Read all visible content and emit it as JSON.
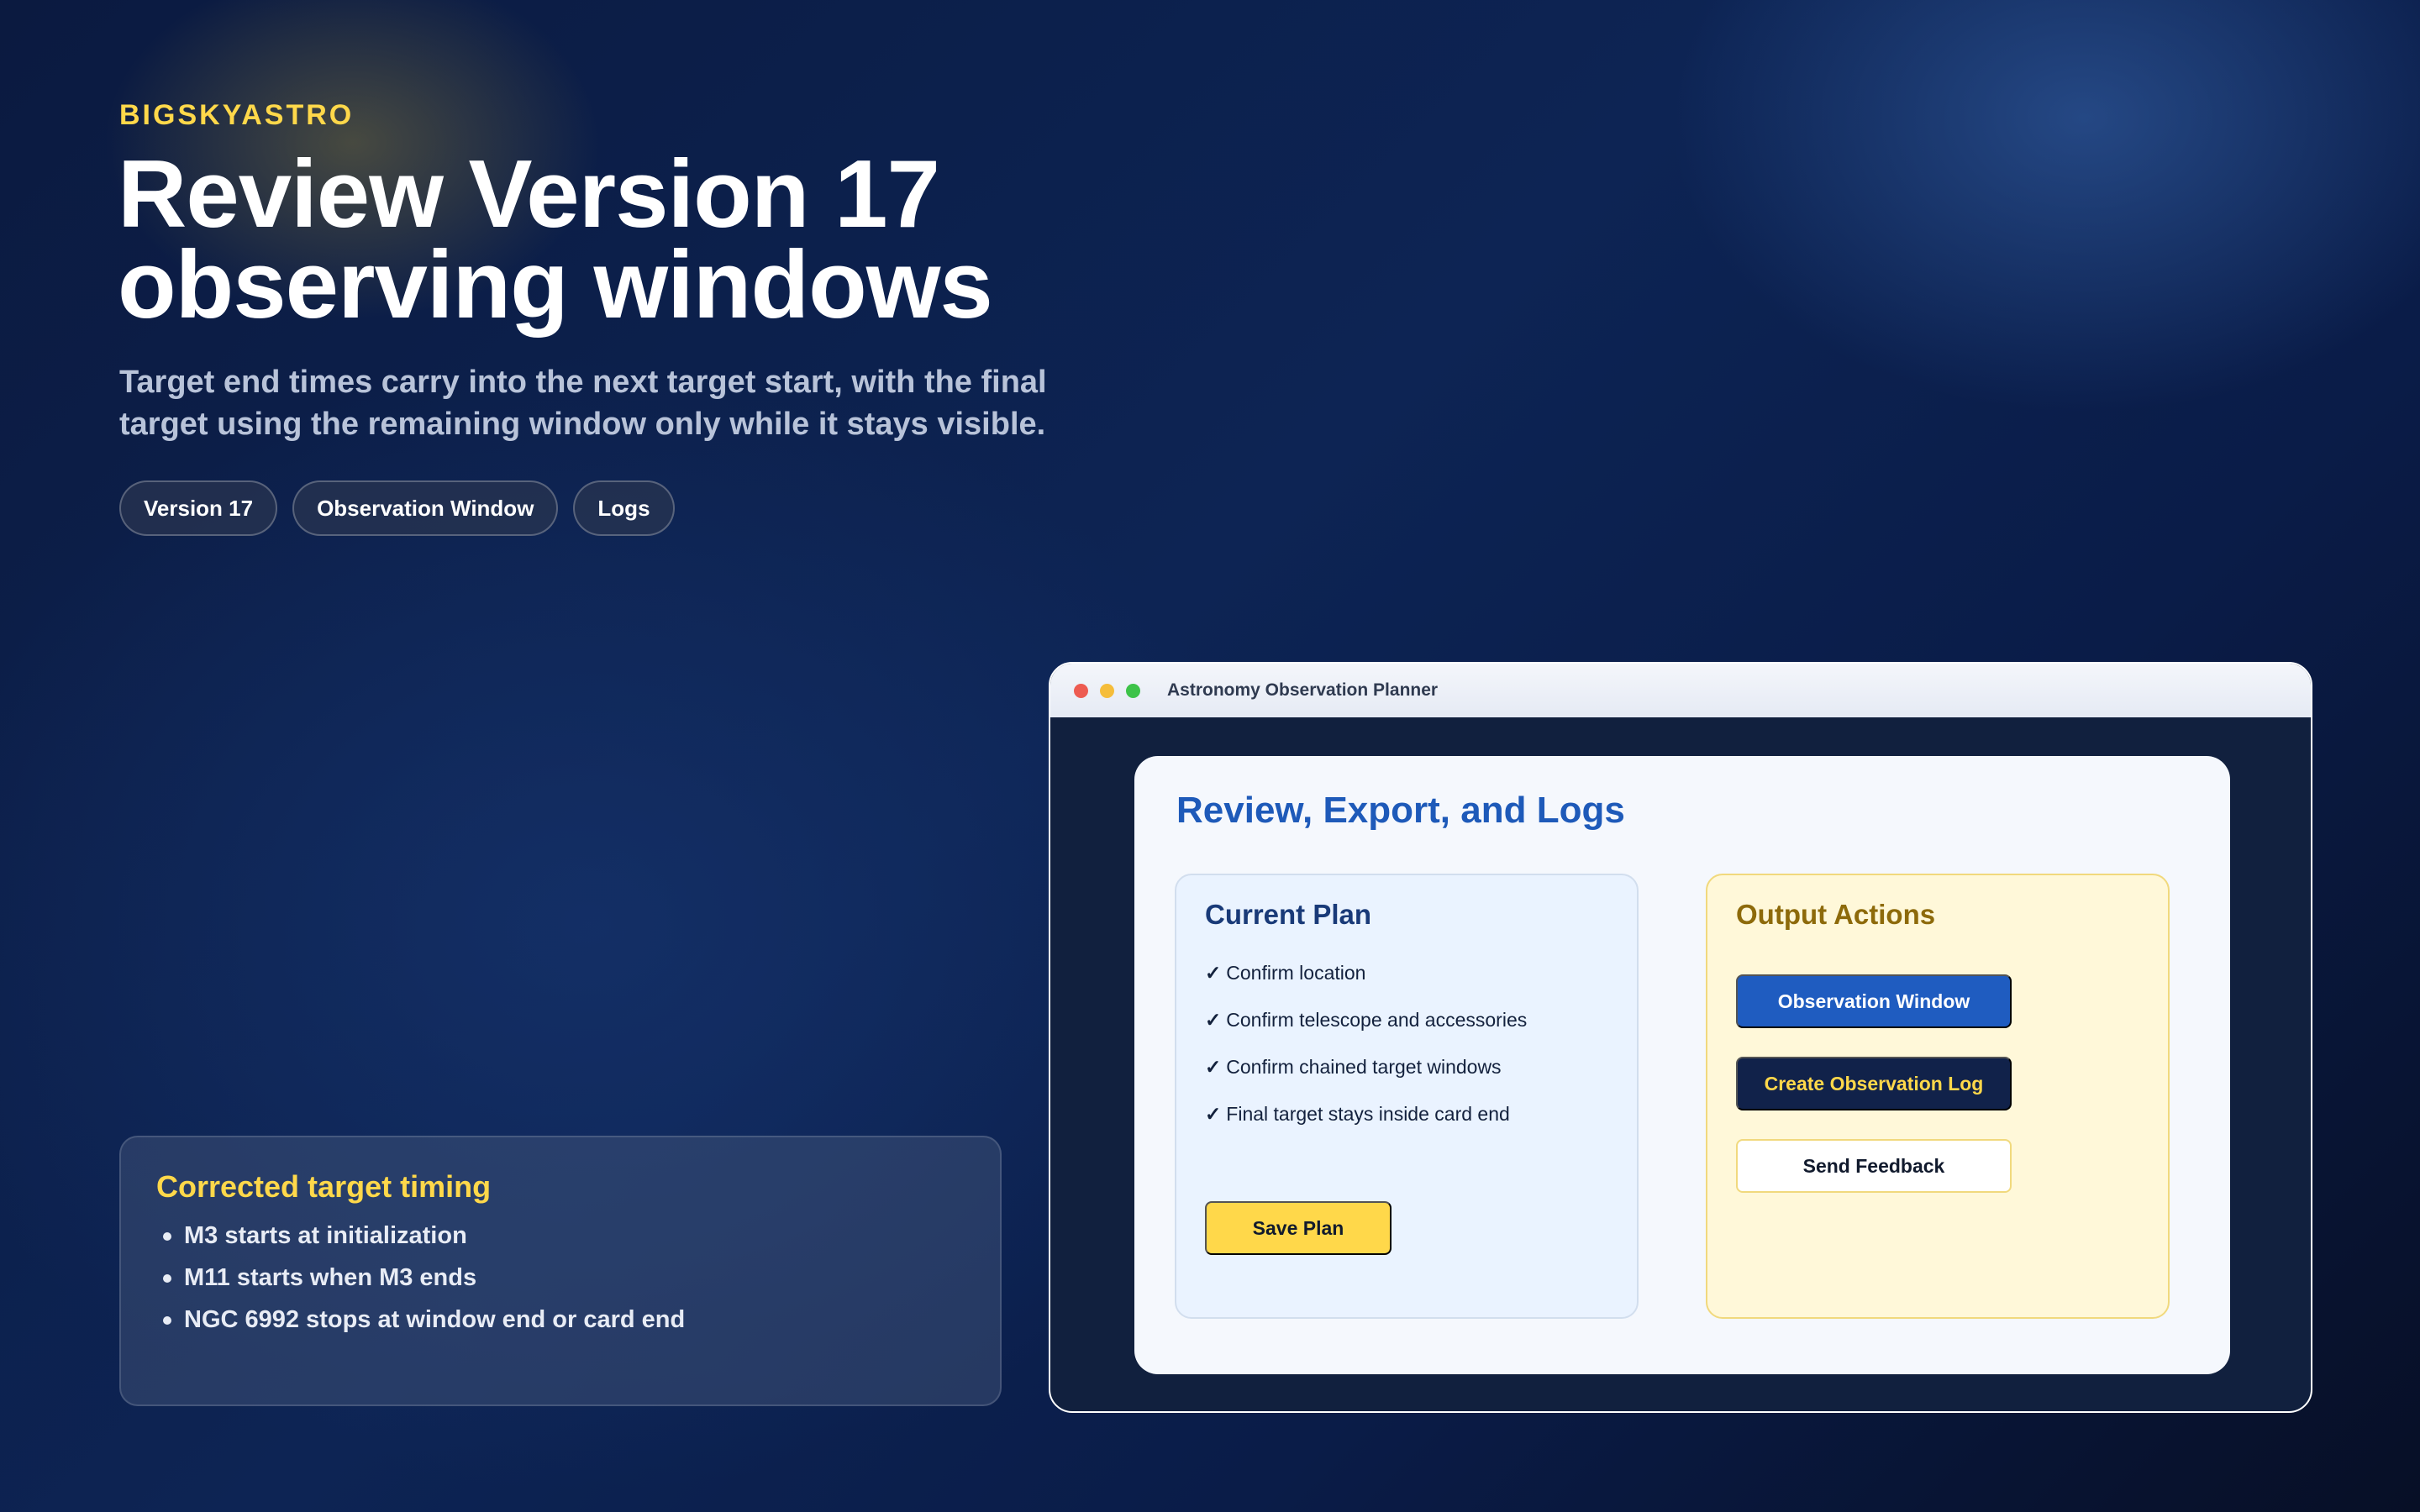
{
  "hero": {
    "brand": "BIGSKYASTRO",
    "headline": "Review Version 17 observing windows",
    "subtitle": "Target end times carry into the next target start, with the final target using the remaining window only while it stays visible.",
    "tags": [
      "Version 17",
      "Observation Window",
      "Logs"
    ]
  },
  "note": {
    "title": "Corrected target timing",
    "items": [
      "M3 starts at initialization",
      "M11 starts when M3 ends",
      "NGC 6992 stops at window end or card end"
    ]
  },
  "window": {
    "title": "Astronomy Observation Planner",
    "heading": "Review, Export, and Logs",
    "plan": {
      "title": "Current Plan",
      "check_mark": "✓",
      "checks": [
        "Confirm location",
        "Confirm telescope and accessories",
        "Confirm chained target windows",
        "Final target stays inside card end"
      ],
      "save_label": "Save Plan"
    },
    "output": {
      "title": "Output Actions",
      "observation_window_label": "Observation Window",
      "create_log_label": "Create Observation Log",
      "feedback_label": "Send Feedback"
    }
  },
  "colors": {
    "brand": "#ffd84a",
    "accent_blue": "#1f5cc0",
    "navy": "#11224a",
    "background": "#0d2454"
  }
}
